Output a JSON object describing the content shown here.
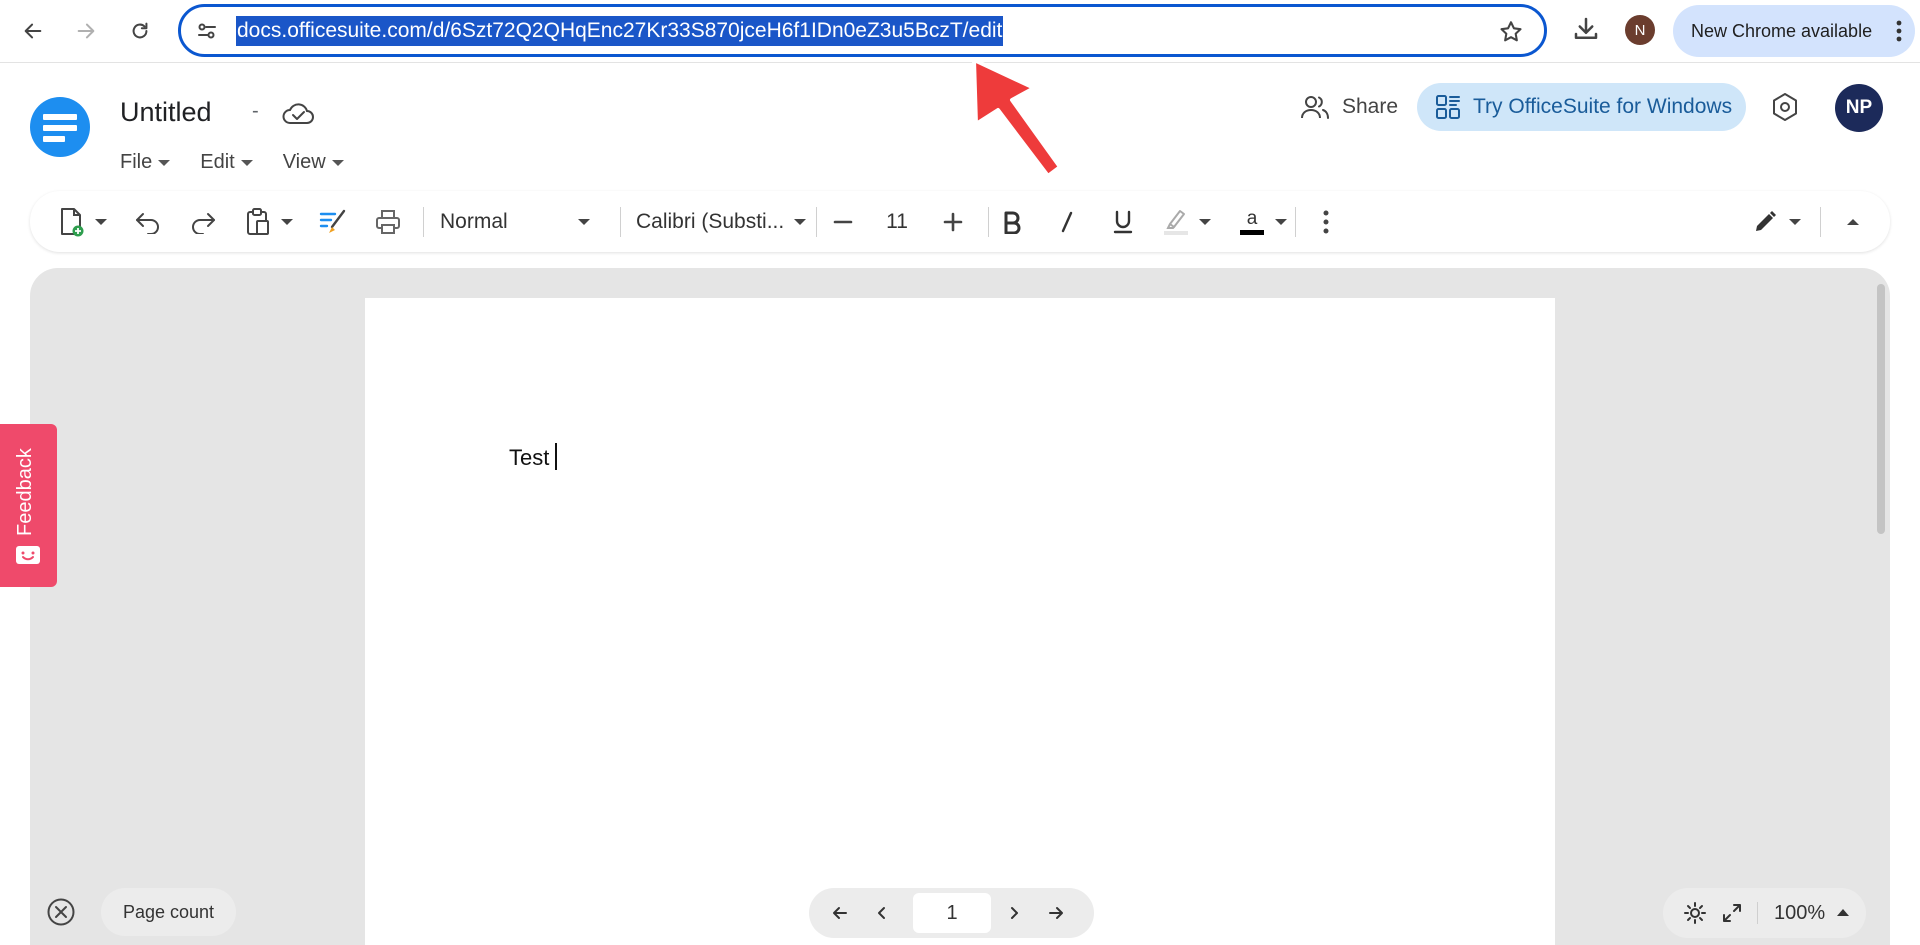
{
  "browser": {
    "url": "docs.officesuite.com/d/6Szt72Q2QHqEnc27Kr33S870jceH6f1IDn0eZ3u5BczT/edit",
    "profile_initial": "N",
    "update_label": "New Chrome available"
  },
  "app": {
    "title": "Untitled",
    "title_separator": "-",
    "menu": [
      "File",
      "Edit",
      "View"
    ],
    "share_label": "Share",
    "try_label": "Try OfficeSuite for Windows",
    "avatar_initials": "NP"
  },
  "toolbar": {
    "style": "Normal",
    "font": "Calibri (Substi...",
    "font_size": "11"
  },
  "document": {
    "text": "Test"
  },
  "feedback": {
    "label": "Feedback"
  },
  "status": {
    "page_count_label": "Page count",
    "current_page": "1",
    "zoom": "100%"
  },
  "colors": {
    "omnibox_border": "#0b57d0",
    "url_selection": "#1a56c8",
    "logo": "#1d8ef0",
    "try_button_bg": "#cfe6f9",
    "avatar_bg": "#1c2a5a",
    "feedback_bg": "#ef4a6b",
    "annotation_arrow": "#ee3b3b"
  }
}
